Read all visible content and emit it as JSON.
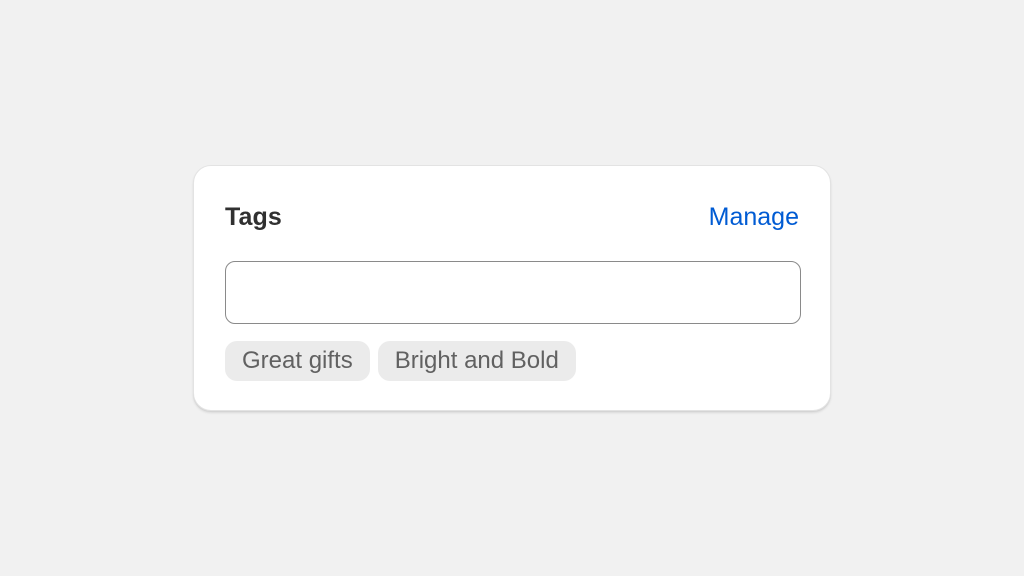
{
  "card": {
    "title": "Tags",
    "manage_label": "Manage",
    "input": {
      "value": "",
      "placeholder": ""
    },
    "tags": [
      "Great gifts",
      "Bright and Bold"
    ]
  },
  "colors": {
    "background": "#f1f1f1",
    "card": "#ffffff",
    "link": "#005bd3",
    "tag_background": "#ebebeb"
  }
}
